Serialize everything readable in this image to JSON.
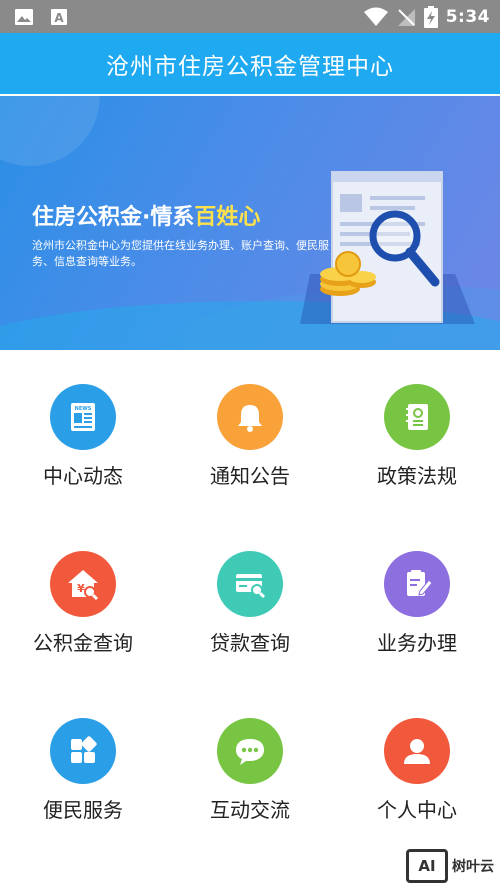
{
  "status_bar": {
    "time": "5:34",
    "icons": [
      "image-icon",
      "font-a-icon",
      "wifi-icon",
      "no-signal-icon",
      "battery-charging-icon"
    ],
    "left_icon2_letter": "A"
  },
  "header": {
    "title": "沧州市住房公积金管理中心"
  },
  "banner": {
    "headline_main": "住房公积金·情系",
    "headline_highlight": "百姓心",
    "subtitle": "沧州市公积金中心为您提供在线业务办理、账户查询、便民服务、信息查询等业务。"
  },
  "menu": {
    "items": [
      {
        "label": "中心动态",
        "icon": "news-icon",
        "color": "#2a9fe8"
      },
      {
        "label": "通知公告",
        "icon": "bell-icon",
        "color": "#f9a23a"
      },
      {
        "label": "政策法规",
        "icon": "policy-book-icon",
        "color": "#78c544"
      },
      {
        "label": "公积金查询",
        "icon": "fund-query-house-icon",
        "color": "#f2583c"
      },
      {
        "label": "贷款查询",
        "icon": "loan-card-search-icon",
        "color": "#3fcab6"
      },
      {
        "label": "业务办理",
        "icon": "business-edit-icon",
        "color": "#8d6fe0"
      },
      {
        "label": "便民服务",
        "icon": "apps-grid-icon",
        "color": "#2a9fe8"
      },
      {
        "label": "互动交流",
        "icon": "chat-bubble-icon",
        "color": "#78c544"
      },
      {
        "label": "个人中心",
        "icon": "user-icon",
        "color": "#f2583c"
      }
    ]
  },
  "watermark": {
    "logo": "AI",
    "text": "树叶云"
  }
}
